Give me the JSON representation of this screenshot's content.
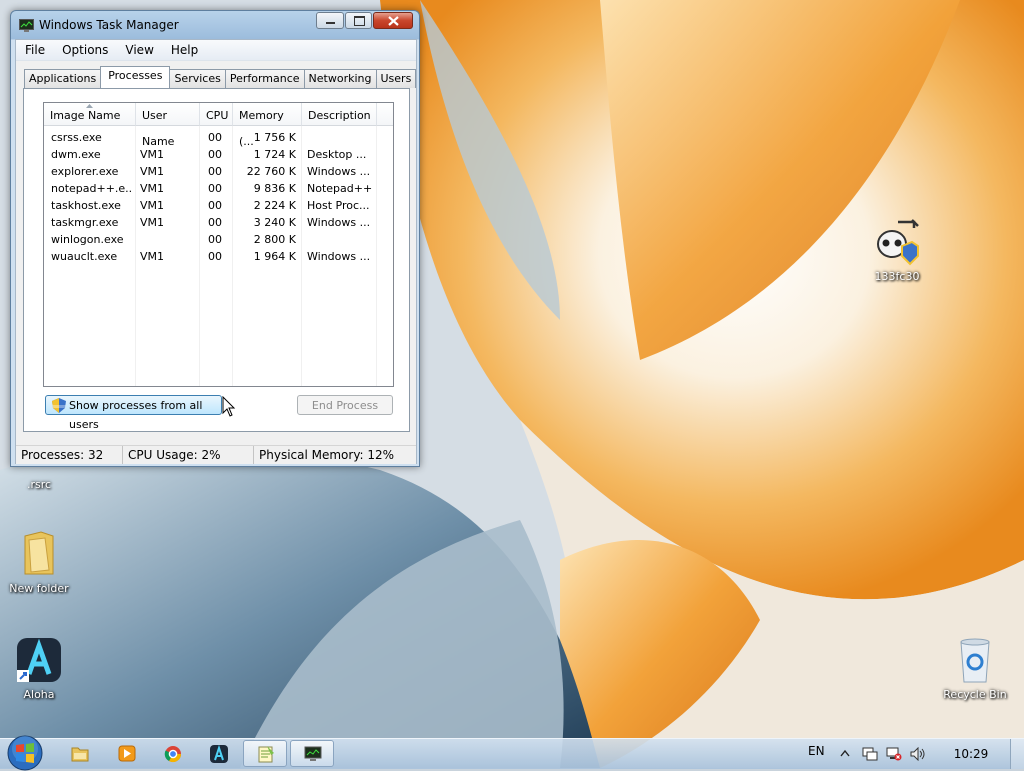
{
  "window": {
    "title": "Windows Task Manager",
    "menu": [
      "File",
      "Options",
      "View",
      "Help"
    ],
    "tabs": [
      "Applications",
      "Processes",
      "Services",
      "Performance",
      "Networking",
      "Users"
    ],
    "active_tab": "Processes",
    "columns": [
      "Image Name",
      "User Name",
      "CPU",
      "Memory (...",
      "Description"
    ],
    "processes": [
      {
        "name": "csrss.exe",
        "user": "",
        "cpu": "00",
        "memory": "1 756 K",
        "desc": ""
      },
      {
        "name": "dwm.exe",
        "user": "VM1",
        "cpu": "00",
        "memory": "1 724 K",
        "desc": "Desktop ..."
      },
      {
        "name": "explorer.exe",
        "user": "VM1",
        "cpu": "00",
        "memory": "22 760 K",
        "desc": "Windows ..."
      },
      {
        "name": "notepad++.e...",
        "user": "VM1",
        "cpu": "00",
        "memory": "9 836 K",
        "desc": "Notepad++"
      },
      {
        "name": "taskhost.exe",
        "user": "VM1",
        "cpu": "00",
        "memory": "2 224 K",
        "desc": "Host Proc..."
      },
      {
        "name": "taskmgr.exe",
        "user": "VM1",
        "cpu": "00",
        "memory": "3 240 K",
        "desc": "Windows ..."
      },
      {
        "name": "winlogon.exe",
        "user": "",
        "cpu": "00",
        "memory": "2 800 K",
        "desc": ""
      },
      {
        "name": "wuauclt.exe",
        "user": "VM1",
        "cpu": "00",
        "memory": "1 964 K",
        "desc": "Windows ..."
      }
    ],
    "show_all_label": "Show processes from all users",
    "end_process_label": "End Process",
    "status": {
      "processes": "Processes: 32",
      "cpu": "CPU Usage: 2%",
      "memory": "Physical Memory: 12%"
    }
  },
  "desktop": {
    "icons": {
      "rsrc": ".rsrc",
      "new_folder": "New folder",
      "aloha": "Aloha",
      "recycle_bin": "Recycle Bin",
      "file133": "133fc30"
    }
  },
  "taskbar": {
    "language": "EN",
    "time": "10:29",
    "pinned": [
      "start-orb-icon",
      "explorer-icon",
      "media-player-icon",
      "chrome-icon",
      "aloha-icon",
      "notepad-icon",
      "task-manager-icon"
    ]
  },
  "colors": {
    "wallpaper_orange": "#f2a23a",
    "wallpaper_cream": "#fbf1e0",
    "wallpaper_blue": "#2f5878",
    "close_button": "#c9462c"
  }
}
